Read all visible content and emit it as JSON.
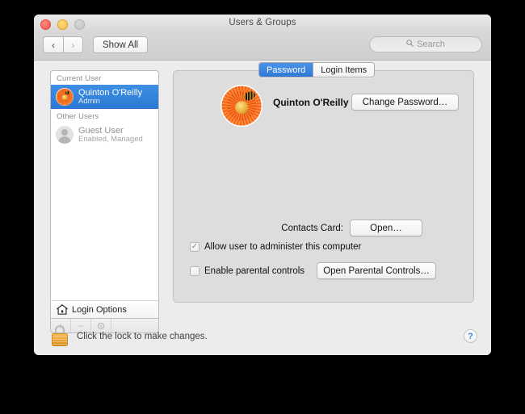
{
  "window": {
    "title": "Users & Groups",
    "traffic_lights": [
      "close",
      "minimize",
      "zoom"
    ]
  },
  "toolbar": {
    "back_glyph": "‹",
    "forward_glyph": "›",
    "show_all_label": "Show All",
    "search_icon": "⚲",
    "search_placeholder": "Search",
    "search_value": ""
  },
  "sidebar": {
    "groups": [
      {
        "header": "Current User",
        "users": [
          {
            "name": "Quinton O'Reilly",
            "role": "Admin",
            "avatar": "flower-avatar",
            "selected": true
          }
        ]
      },
      {
        "header": "Other Users",
        "users": [
          {
            "name": "Guest User",
            "role": "Enabled, Managed",
            "avatar": "person-avatar",
            "selected": false
          }
        ]
      }
    ],
    "login_options_label": "Login Options",
    "login_options_icon": "home-icon",
    "buttons": [
      {
        "icon": "plus-icon",
        "glyph": "+",
        "enabled": false
      },
      {
        "icon": "minus-icon",
        "glyph": "−",
        "enabled": false
      },
      {
        "icon": "gear-icon",
        "glyph": "⚙",
        "enabled": false
      }
    ]
  },
  "main": {
    "tabs": [
      {
        "label": "Password",
        "active": true
      },
      {
        "label": "Login Items",
        "active": false
      }
    ],
    "account_name": "Quinton O'Reilly",
    "account_avatar": "flower-avatar",
    "change_password_label": "Change Password…",
    "contacts_card_label": "Contacts Card:",
    "contacts_open_label": "Open…",
    "admin_checkbox": {
      "label": "Allow user to administer this computer",
      "checked": true,
      "check_glyph": "✓"
    },
    "parental_checkbox": {
      "label": "Enable parental controls",
      "checked": false,
      "check_glyph": ""
    },
    "parental_button_label": "Open Parental Controls…"
  },
  "footer": {
    "lock_icon": "lock-closed-icon",
    "lock_text": "Click the lock to make changes.",
    "help_label": "?"
  },
  "colors": {
    "accent_blue": "#3b82e0",
    "selection_blue": "#2f79d8",
    "lock_gold": "#eda735",
    "panel_grey": "#dddddd",
    "window_grey": "#ececec"
  }
}
